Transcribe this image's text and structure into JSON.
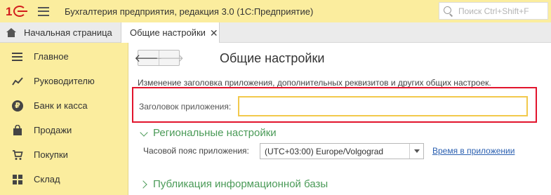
{
  "window": {
    "title": "Бухгалтерия предприятия, редакция 3.0  (1С:Предприятие)",
    "search_placeholder": "Поиск Ctrl+Shift+F",
    "logo_text": "1С"
  },
  "tabs": {
    "home_label": "Начальная страница",
    "active_label": "Общие настройки",
    "close_glyph": "✕"
  },
  "sidebar": {
    "items": [
      {
        "label": "Главное",
        "icon": "menu-icon"
      },
      {
        "label": "Руководителю",
        "icon": "chart-line-icon"
      },
      {
        "label": "Банк и касса",
        "icon": "ruble-coin-icon"
      },
      {
        "label": "Продажи",
        "icon": "shopping-bag-icon"
      },
      {
        "label": "Покупки",
        "icon": "cart-icon"
      },
      {
        "label": "Склад",
        "icon": "warehouse-icon"
      }
    ]
  },
  "main": {
    "nav_back": "🡐",
    "nav_forward": "🡒",
    "title": "Общие настройки",
    "description": "Изменение заголовка приложения, дополнительных реквизитов и других общих настроек.",
    "app_title_field": {
      "label": "Заголовок приложения:",
      "value": ""
    },
    "regional_section": "Региональные настройки",
    "timezone": {
      "label": "Часовой пояс приложения:",
      "value": "(UTC+03:00) Europe/Volgograd",
      "link": "Время в приложении"
    },
    "publication_section": "Публикация информационной базы"
  },
  "colors": {
    "sidebar_bg": "#fbed9e",
    "accent_green": "#4a9a57",
    "highlight_red": "#e2142c",
    "input_border": "#f2c94c",
    "link_blue": "#2a5fb0"
  }
}
